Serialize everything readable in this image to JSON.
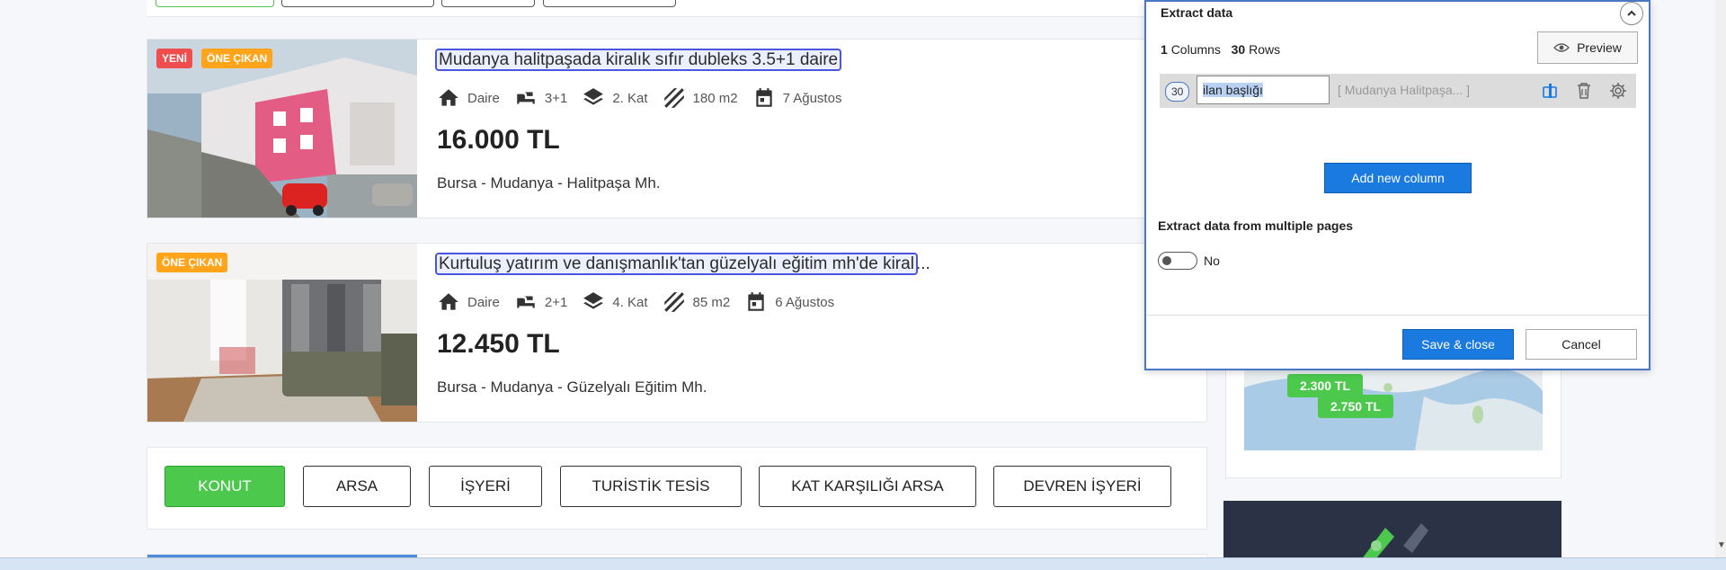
{
  "listings": [
    {
      "badges": [
        "YENİ",
        "ÖNE ÇIKAN"
      ],
      "title": "Mudanya halitpaşada kiralık sıfır dubleks 3.5+1 daire",
      "title_rest": "",
      "type": "Daire",
      "rooms": "3+1",
      "floor": "2. Kat",
      "area": "180 m2",
      "date": "7 Ağustos",
      "price": "16.000 TL",
      "location": "Bursa - Mudanya - Halitpaşa Mh."
    },
    {
      "badges": [
        "ÖNE ÇIKAN"
      ],
      "title": "Kurtuluş yatırım ve danışmanlık'tan güzelyalı eğitim mh'de kiral",
      "title_rest": "...",
      "type": "Daire",
      "rooms": "2+1",
      "floor": "4. Kat",
      "area": "85 m2",
      "date": "6 Ağustos",
      "price": "12.450 TL",
      "location": "Bursa - Mudanya - Güzelyalı Eğitim Mh."
    }
  ],
  "categories": [
    "KONUT",
    "ARSA",
    "İŞYERİ",
    "TURİSTİK TESİS",
    "KAT KARŞILIĞI ARSA",
    "DEVREN İŞYERİ"
  ],
  "active_category": "KONUT",
  "map": {
    "pins": [
      "2.300 TL",
      "2.750 TL"
    ]
  },
  "extract_panel": {
    "title": "Extract data",
    "columns_count": "1",
    "columns_label": "Columns",
    "rows_count": "30",
    "rows_label": "Rows",
    "preview_label": "Preview",
    "column": {
      "count": "30",
      "name": "ilan başlığı",
      "sample": "[ Mudanya Halitpaşa...  ]"
    },
    "add_column_label": "Add new column",
    "multi_pages_label": "Extract data from multiple pages",
    "multi_pages_value": "No",
    "save_label": "Save & close",
    "cancel_label": "Cancel"
  },
  "colors": {
    "accent_green": "#4cc94c",
    "badge_new": "#f04e4e",
    "badge_featured": "#ffa41b",
    "panel_blue": "#1a7ae0"
  }
}
